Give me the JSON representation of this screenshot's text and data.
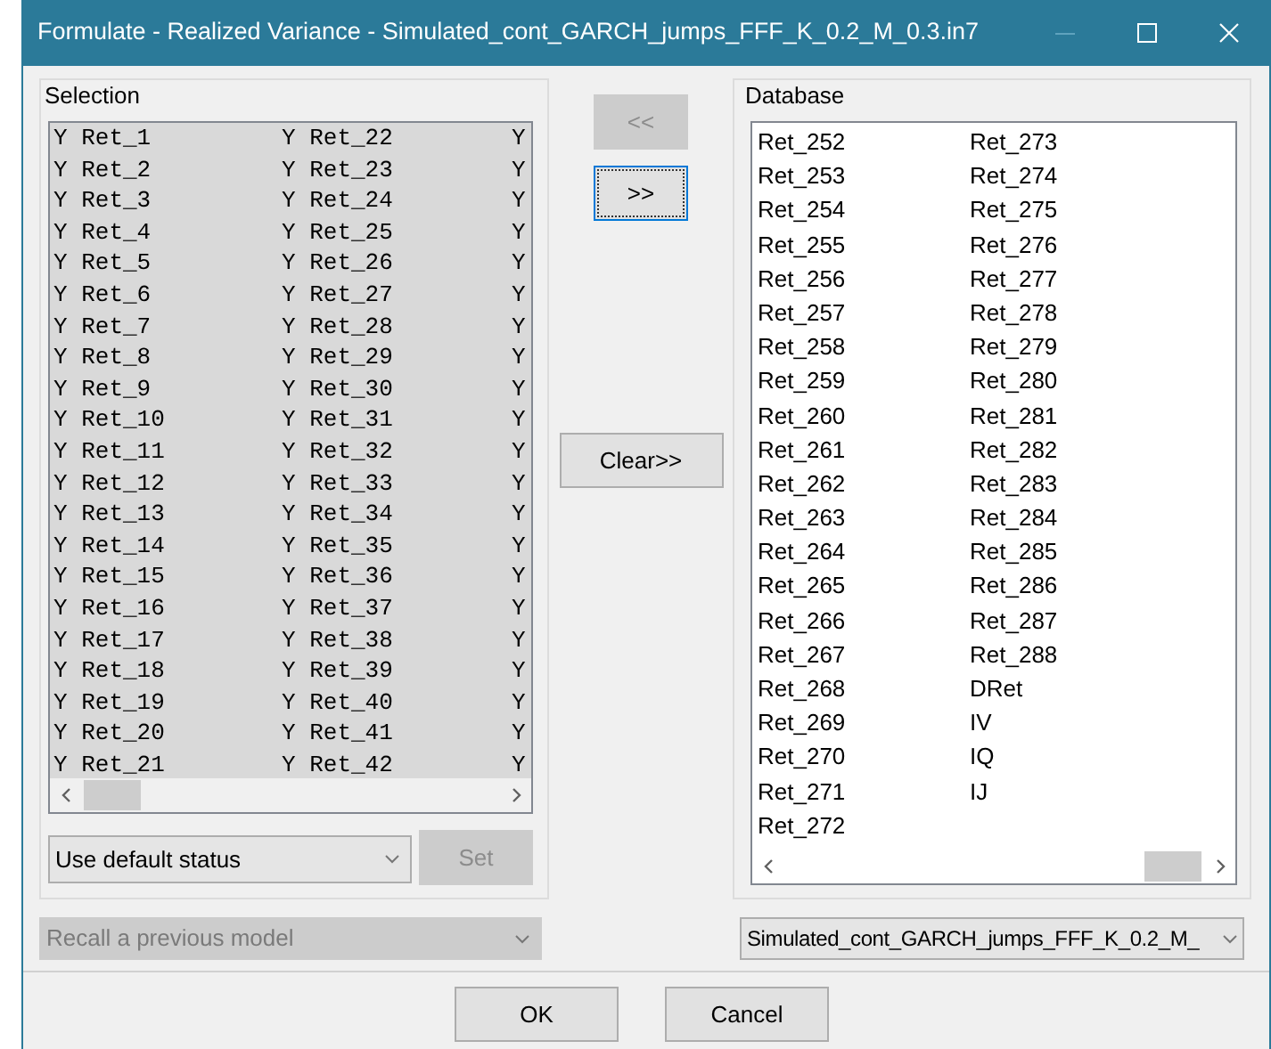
{
  "window": {
    "title": "Formulate - Realized Variance - Simulated_cont_GARCH_jumps_FFF_K_0.2_M_0.3.in7"
  },
  "selection": {
    "label": "Selection",
    "columns": [
      [
        {
          "status": "Y",
          "name": "Ret_1",
          "selected": true
        },
        {
          "status": "Y",
          "name": "Ret_2",
          "selected": true
        },
        {
          "status": "Y",
          "name": "Ret_3",
          "selected": true
        },
        {
          "status": "Y",
          "name": "Ret_4",
          "selected": true
        },
        {
          "status": "Y",
          "name": "Ret_5",
          "selected": true
        },
        {
          "status": "Y",
          "name": "Ret_6",
          "selected": true
        },
        {
          "status": "Y",
          "name": "Ret_7",
          "selected": true
        },
        {
          "status": "Y",
          "name": "Ret_8",
          "selected": true
        },
        {
          "status": "Y",
          "name": "Ret_9",
          "selected": true
        },
        {
          "status": "Y",
          "name": "Ret_10",
          "selected": true
        },
        {
          "status": "Y",
          "name": "Ret_11",
          "selected": true
        },
        {
          "status": "Y",
          "name": "Ret_12",
          "selected": true
        },
        {
          "status": "Y",
          "name": "Ret_13",
          "selected": true
        },
        {
          "status": "Y",
          "name": "Ret_14",
          "selected": true
        },
        {
          "status": "Y",
          "name": "Ret_15",
          "selected": true
        },
        {
          "status": "Y",
          "name": "Ret_16",
          "selected": true
        },
        {
          "status": "Y",
          "name": "Ret_17",
          "selected": true
        },
        {
          "status": "Y",
          "name": "Ret_18",
          "selected": true
        },
        {
          "status": "Y",
          "name": "Ret_19",
          "selected": true
        },
        {
          "status": "Y",
          "name": "Ret_20",
          "selected": true
        },
        {
          "status": "Y",
          "name": "Ret_21",
          "selected": true
        }
      ],
      [
        {
          "status": "Y",
          "name": "Ret_22",
          "selected": true
        },
        {
          "status": "Y",
          "name": "Ret_23",
          "selected": true
        },
        {
          "status": "Y",
          "name": "Ret_24",
          "selected": true
        },
        {
          "status": "Y",
          "name": "Ret_25",
          "selected": true
        },
        {
          "status": "Y",
          "name": "Ret_26",
          "selected": true
        },
        {
          "status": "Y",
          "name": "Ret_27",
          "selected": true
        },
        {
          "status": "Y",
          "name": "Ret_28",
          "selected": true
        },
        {
          "status": "Y",
          "name": "Ret_29",
          "selected": true
        },
        {
          "status": "Y",
          "name": "Ret_30",
          "selected": true
        },
        {
          "status": "Y",
          "name": "Ret_31",
          "selected": true
        },
        {
          "status": "Y",
          "name": "Ret_32",
          "selected": true
        },
        {
          "status": "Y",
          "name": "Ret_33",
          "selected": true
        },
        {
          "status": "Y",
          "name": "Ret_34",
          "selected": true
        },
        {
          "status": "Y",
          "name": "Ret_35",
          "selected": true
        },
        {
          "status": "Y",
          "name": "Ret_36",
          "selected": true
        },
        {
          "status": "Y",
          "name": "Ret_37",
          "selected": true
        },
        {
          "status": "Y",
          "name": "Ret_38",
          "selected": true
        },
        {
          "status": "Y",
          "name": "Ret_39",
          "selected": true
        },
        {
          "status": "Y",
          "name": "Ret_40",
          "selected": true
        },
        {
          "status": "Y",
          "name": "Ret_41",
          "selected": true
        },
        {
          "status": "Y",
          "name": "Ret_42",
          "selected": true
        }
      ],
      [
        {
          "status": "Y",
          "selected": true
        },
        {
          "status": "Y",
          "selected": true
        },
        {
          "status": "Y",
          "selected": true
        },
        {
          "status": "Y",
          "selected": true
        },
        {
          "status": "Y",
          "selected": true
        },
        {
          "status": "Y",
          "selected": true
        },
        {
          "status": "Y",
          "selected": true
        },
        {
          "status": "Y",
          "selected": true
        },
        {
          "status": "Y",
          "selected": true
        },
        {
          "status": "Y",
          "selected": true
        },
        {
          "status": "Y",
          "selected": true
        },
        {
          "status": "Y",
          "selected": true
        },
        {
          "status": "Y",
          "selected": true
        },
        {
          "status": "Y",
          "selected": true
        },
        {
          "status": "Y",
          "selected": true
        },
        {
          "status": "Y",
          "selected": true
        },
        {
          "status": "Y",
          "selected": true
        },
        {
          "status": "Y",
          "selected": true
        },
        {
          "status": "Y",
          "selected": true
        },
        {
          "status": "Y",
          "selected": true
        },
        {
          "status": "Y",
          "selected": true
        }
      ]
    ],
    "status_select": {
      "value": "Use default status"
    },
    "set_button": {
      "label": "Set",
      "disabled": true
    }
  },
  "transfer_buttons": [
    {
      "label": "<<",
      "disabled": true,
      "focused": false
    },
    {
      "label": ">>",
      "disabled": false,
      "focused": true
    }
  ],
  "clear_button": {
    "label": "Clear>>"
  },
  "database": {
    "label": "Database",
    "columns": [
      [
        "Ret_252",
        "Ret_253",
        "Ret_254",
        "Ret_255",
        "Ret_256",
        "Ret_257",
        "Ret_258",
        "Ret_259",
        "Ret_260",
        "Ret_261",
        "Ret_262",
        "Ret_263",
        "Ret_264",
        "Ret_265",
        "Ret_266",
        "Ret_267",
        "Ret_268",
        "Ret_269",
        "Ret_270",
        "Ret_271",
        "Ret_272"
      ],
      [
        "Ret_273",
        "Ret_274",
        "Ret_275",
        "Ret_276",
        "Ret_277",
        "Ret_278",
        "Ret_279",
        "Ret_280",
        "Ret_281",
        "Ret_282",
        "Ret_283",
        "Ret_284",
        "Ret_285",
        "Ret_286",
        "Ret_287",
        "Ret_288",
        "DRet",
        "IV",
        "IQ",
        "IJ"
      ]
    ]
  },
  "recall_select": {
    "value": "Recall a previous model",
    "disabled": true
  },
  "database_select": {
    "value": "Simulated_cont_GARCH_jumps_FFF_K_0.2_M_",
    "disabled": false
  },
  "buttons": [
    {
      "label": "OK"
    },
    {
      "label": "Cancel"
    }
  ]
}
